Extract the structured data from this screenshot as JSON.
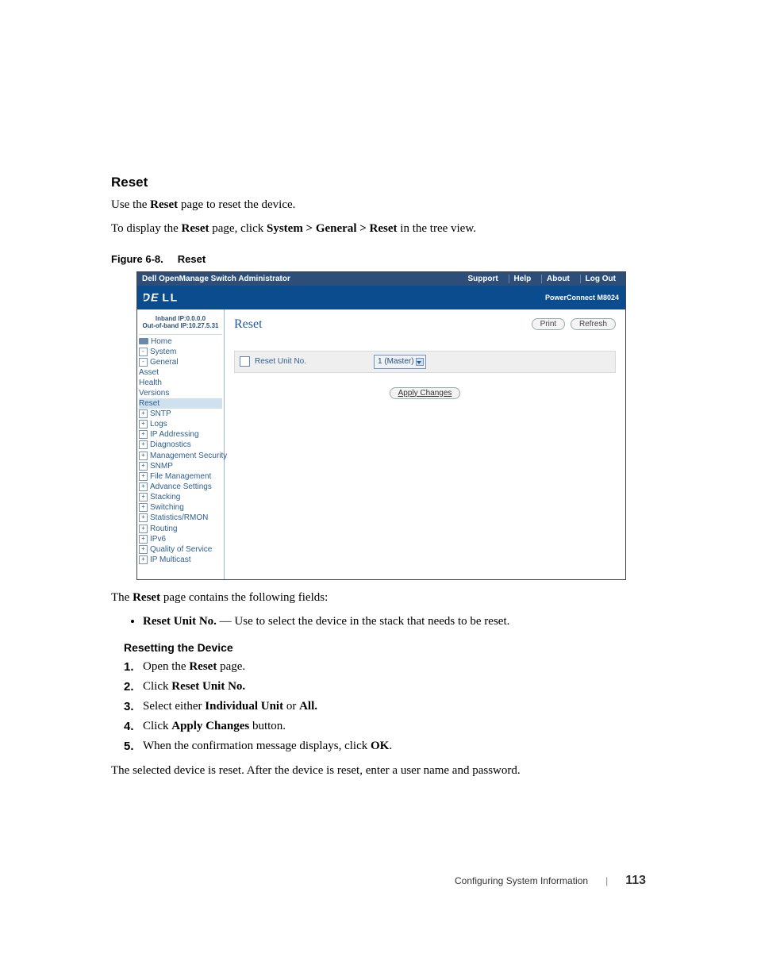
{
  "doc": {
    "section_title": "Reset",
    "intro1_a": "Use the ",
    "intro1_b": "Reset",
    "intro1_c": " page to reset the device.",
    "intro2_a": "To display the ",
    "intro2_b": "Reset",
    "intro2_c": " page, click ",
    "intro2_d": "System > General > Reset",
    "intro2_e": " in the tree view.",
    "figcap_a": "Figure 6-8.",
    "figcap_b": "Reset",
    "after_fig_a": "The ",
    "after_fig_b": "Reset",
    "after_fig_c": " page contains the following fields:",
    "bullet1_a": "Reset Unit No.",
    "bullet1_b": " — Use to select the device in the stack that needs to be reset.",
    "subhead": "Resetting the Device",
    "step1_a": "Open the ",
    "step1_b": "Reset",
    "step1_c": " page.",
    "step2_a": "Click ",
    "step2_b": "Reset Unit No.",
    "step3_a": "Select either ",
    "step3_b": "Individual Unit",
    "step3_c": " or ",
    "step3_d": "All.",
    "step4_a": "Click ",
    "step4_b": "Apply Changes",
    "step4_c": " button.",
    "step5_a": "When the confirmation message displays, click ",
    "step5_b": "OK",
    "step5_c": ".",
    "step5_extra": "The selected device is reset. After the device is reset, enter a user name and password.",
    "footer_section": "Configuring System Information",
    "footer_page": "113"
  },
  "shot": {
    "titlebar": "Dell OpenManage Switch Administrator",
    "links": {
      "support": "Support",
      "help": "Help",
      "about": "About",
      "logout": "Log Out"
    },
    "model": "PowerConnect M8024",
    "ip": {
      "inband": "Inband IP:0.0.0.0",
      "oob": "Out-of-band IP:10.27.5.31"
    },
    "tree": {
      "home": "Home",
      "system": "System",
      "general": "General",
      "asset": "Asset",
      "health": "Health",
      "versions": "Versions",
      "reset": "Reset",
      "sntp": "SNTP",
      "logs": "Logs",
      "ipaddr": "IP Addressing",
      "diag": "Diagnostics",
      "mgmtsec": "Management Security",
      "snmp": "SNMP",
      "filemgmt": "File Management",
      "advance": "Advance Settings",
      "stacking": "Stacking",
      "switching": "Switching",
      "statsrmon": "Statistics/RMON",
      "routing": "Routing",
      "ipv6": "IPv6",
      "qos": "Quality of Service",
      "ipmc": "IP Multicast"
    },
    "content": {
      "title": "Reset",
      "print": "Print",
      "refresh": "Refresh",
      "field_label": "Reset Unit No.",
      "select_value": "1 (Master)",
      "apply": "Apply Changes"
    }
  }
}
